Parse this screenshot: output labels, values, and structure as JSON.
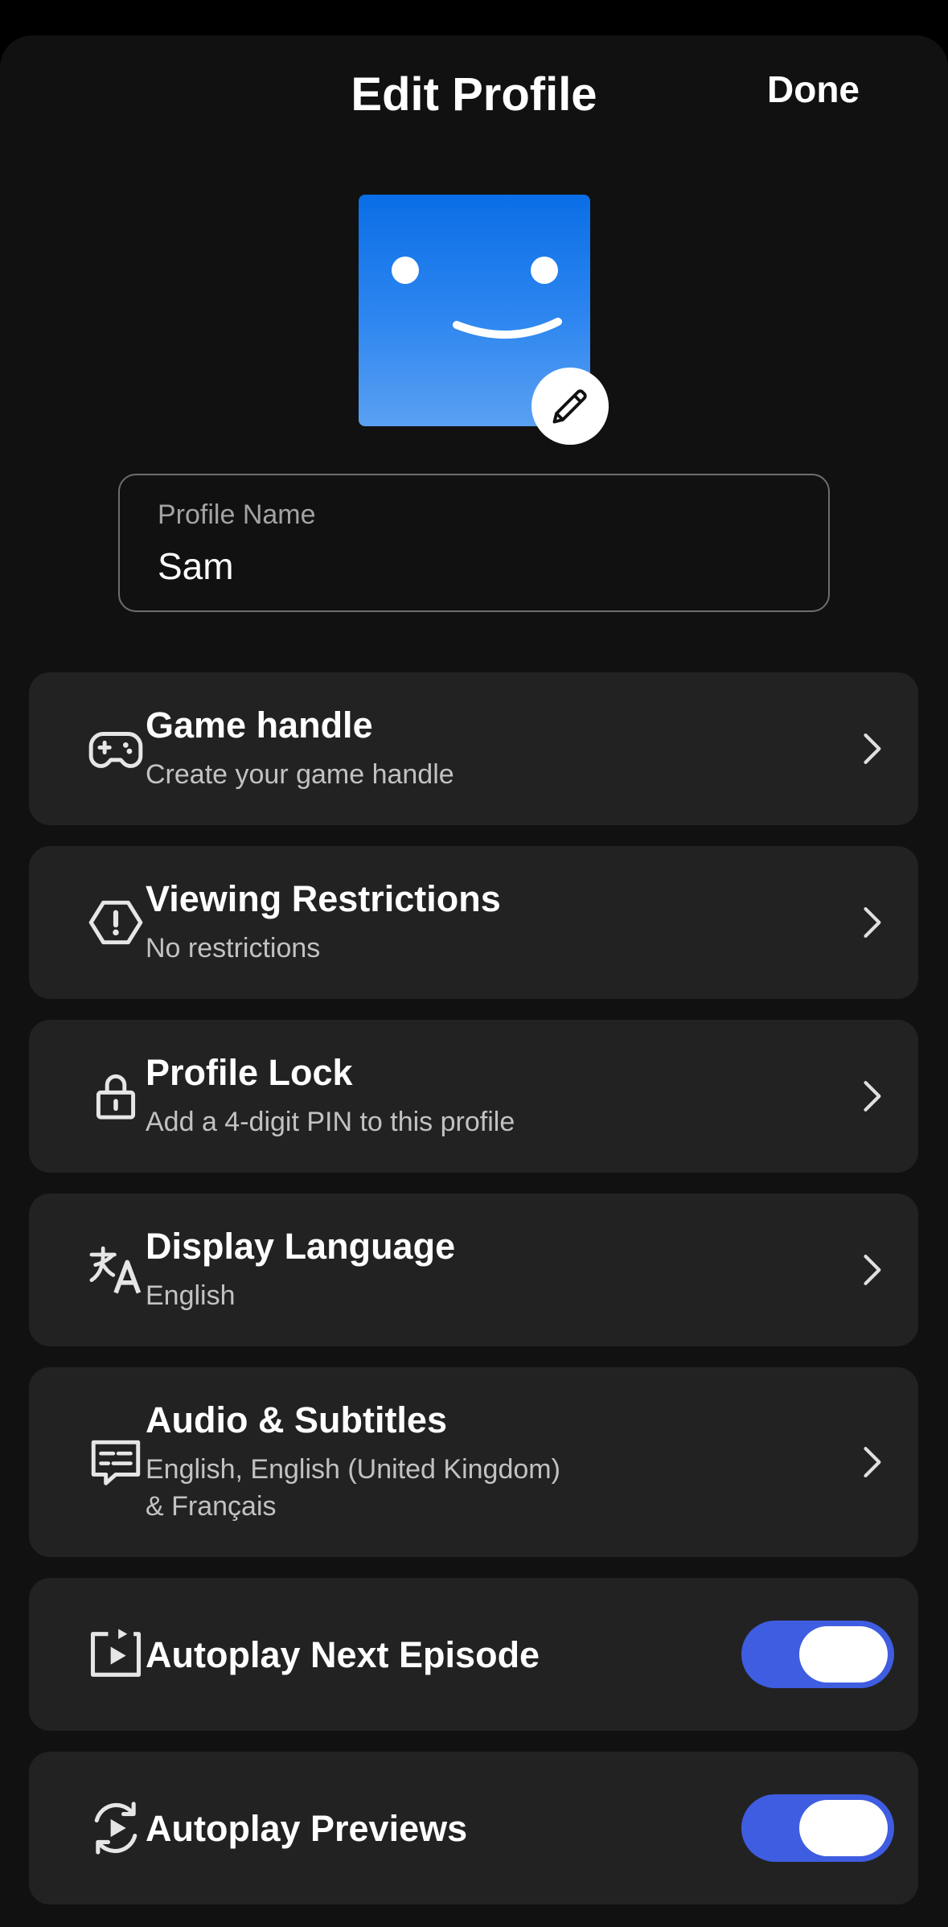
{
  "header": {
    "title": "Edit Profile",
    "done_label": "Done"
  },
  "avatar": {
    "icon": "smiley-face-avatar",
    "colors": [
      "#0a6ee6",
      "#5aa0f2"
    ],
    "edit_icon": "pencil-icon"
  },
  "profile_name": {
    "label": "Profile Name",
    "value": "Sam"
  },
  "settings": [
    {
      "icon": "gamepad-icon",
      "title": "Game handle",
      "subtitle": "Create your game handle"
    },
    {
      "icon": "warning-hexagon-icon",
      "title": "Viewing Restrictions",
      "subtitle": "No restrictions"
    },
    {
      "icon": "lock-icon",
      "title": "Profile Lock",
      "subtitle": "Add a 4-digit PIN to this profile"
    },
    {
      "icon": "translate-icon",
      "title": "Display Language",
      "subtitle": "English"
    },
    {
      "icon": "subtitles-icon",
      "title": "Audio & Subtitles",
      "subtitle": "English, English (United Kingdom)\n& Français"
    }
  ],
  "toggles": [
    {
      "icon": "autoplay-next-icon",
      "title": "Autoplay Next Episode",
      "on": true
    },
    {
      "icon": "autoplay-previews-icon",
      "title": "Autoplay Previews",
      "on": true
    }
  ],
  "colors": {
    "background": "#111111",
    "card": "#222222",
    "toggle_on": "#3f5de0",
    "subtitle_text": "#c2c2c2"
  }
}
